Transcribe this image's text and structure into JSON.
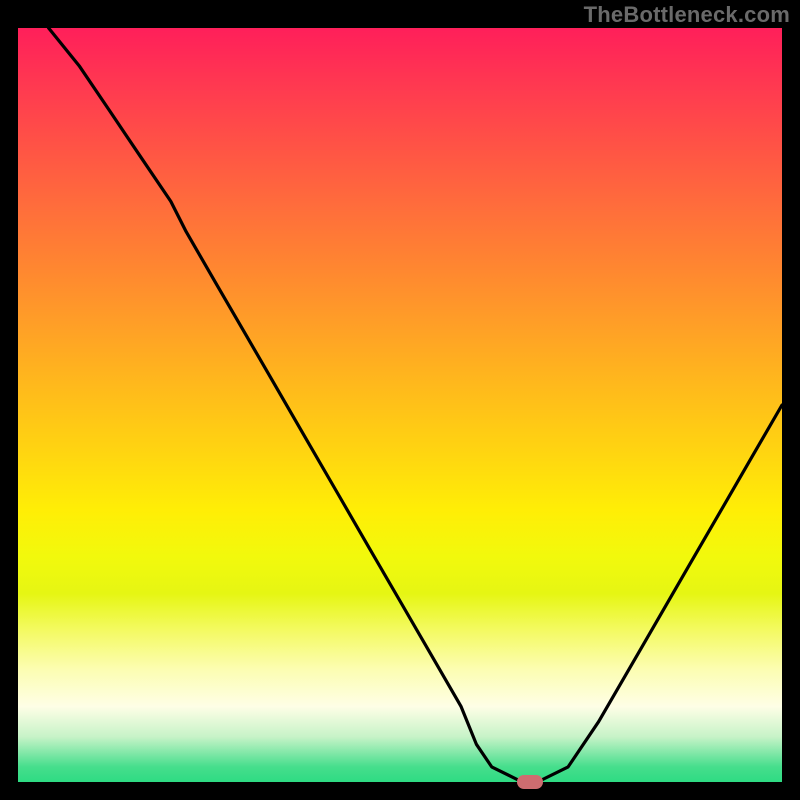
{
  "watermark": "TheBottleneck.com",
  "chart_data": {
    "type": "line",
    "title": "",
    "xlabel": "",
    "ylabel": "",
    "xlim": [
      0,
      100
    ],
    "ylim": [
      0,
      100
    ],
    "grid": false,
    "series": [
      {
        "name": "curve",
        "x": [
          4,
          8,
          12,
          16,
          20,
          22,
          26,
          30,
          34,
          38,
          42,
          46,
          50,
          54,
          58,
          60,
          62,
          66,
          68,
          72,
          76,
          80,
          84,
          88,
          92,
          96,
          100
        ],
        "y": [
          100,
          95,
          89,
          83,
          77,
          73,
          66,
          59,
          52,
          45,
          38,
          31,
          24,
          17,
          10,
          5,
          2,
          0,
          0,
          2,
          8,
          15,
          22,
          29,
          36,
          43,
          50
        ]
      }
    ],
    "marker": {
      "x": 67,
      "y": 0,
      "color": "#CE6C70"
    },
    "colors": {
      "curve": "#000000",
      "frame": "#000000",
      "background_top": "#FF1F5A",
      "background_bottom": "#2EDB83"
    }
  }
}
